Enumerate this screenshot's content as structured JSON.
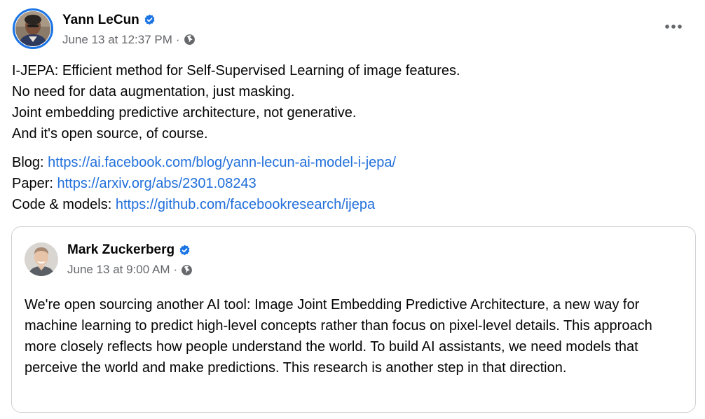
{
  "post": {
    "author": "Yann LeCun",
    "timestamp": "June 13 at 12:37 PM",
    "separator": "·",
    "verified_icon": "verified-badge-icon",
    "audience_icon": "globe-icon",
    "more_icon": "more-options-icon",
    "paragraphs": [
      "I-JEPA: Efficient method for Self-Supervised Learning of image features.",
      "No need for data augmentation, just masking.",
      "Joint embedding predictive architecture, not generative.",
      "And it's open source, of course."
    ],
    "links": [
      {
        "label": "Blog: ",
        "url": "https://ai.facebook.com/blog/yann-lecun-ai-model-i-jepa/"
      },
      {
        "label": "Paper: ",
        "url": "https://arxiv.org/abs/2301.08243"
      },
      {
        "label": "Code & models: ",
        "url": "https://github.com/facebookresearch/ijepa"
      }
    ]
  },
  "shared": {
    "author": "Mark Zuckerberg",
    "timestamp": "June 13 at 9:00 AM",
    "separator": "·",
    "text": "We're open sourcing another AI tool: Image Joint Embedding Predictive Architecture, a new way for machine learning to predict high-level concepts rather than focus on pixel-level details. This approach more closely reflects how people understand the world. To build AI assistants, we need models that perceive the world and make predictions. This research is another step in that direction."
  },
  "colors": {
    "link": "#216fdb",
    "verified": "#1b74e4",
    "meta": "#65676b",
    "border": "#ced0d4"
  }
}
